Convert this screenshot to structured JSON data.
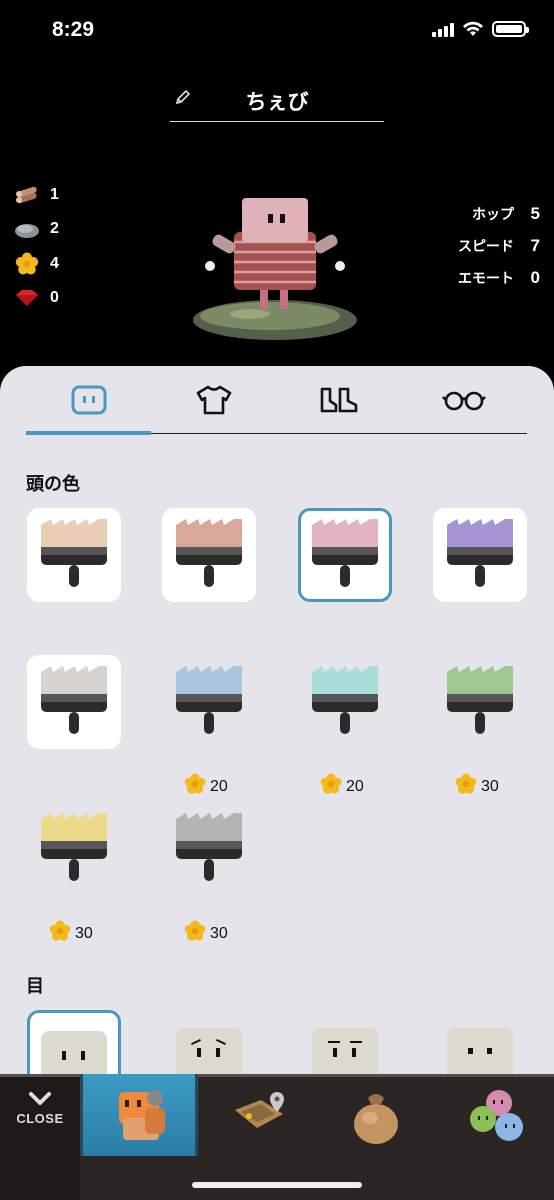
{
  "status_bar": {
    "time": "8:29"
  },
  "header": {
    "character_name": "ちぇび",
    "edit_icon": "pencil-icon"
  },
  "resources": [
    {
      "icon": "wood-logs-icon",
      "value": "1"
    },
    {
      "icon": "stone-icon",
      "value": "2"
    },
    {
      "icon": "flower-icon",
      "value": "4"
    },
    {
      "icon": "ruby-gem-icon",
      "value": "0"
    }
  ],
  "stats": [
    {
      "label": "ホップ",
      "value": "5"
    },
    {
      "label": "スピード",
      "value": "7"
    },
    {
      "label": "エモート",
      "value": "0"
    }
  ],
  "tabs": [
    {
      "icon": "face-icon",
      "active": true
    },
    {
      "icon": "shirt-icon",
      "active": false
    },
    {
      "icon": "boots-icon",
      "active": false
    },
    {
      "icon": "glasses-icon",
      "active": false
    }
  ],
  "head_color_section": {
    "title": "頭の色",
    "colors": [
      {
        "color": "#e9cdb4",
        "price": "",
        "owned": true,
        "selected": false
      },
      {
        "color": "#d8a899",
        "price": "",
        "owned": true,
        "selected": false
      },
      {
        "color": "#e2b3c0",
        "price": "",
        "owned": true,
        "selected": true
      },
      {
        "color": "#a794d3",
        "price": "",
        "owned": true,
        "selected": false
      },
      {
        "color": "#d6d4ce",
        "price": "",
        "owned": true,
        "selected": false
      },
      {
        "color": "#a9c6dd",
        "price": "20",
        "owned": false,
        "selected": false
      },
      {
        "color": "#a9dddb",
        "price": "20",
        "owned": false,
        "selected": false
      },
      {
        "color": "#9dc990",
        "price": "30",
        "owned": false,
        "selected": false
      },
      {
        "color": "#ecd98a",
        "price": "30",
        "owned": false,
        "selected": false
      },
      {
        "color": "#b5b4b5",
        "price": "30",
        "owned": false,
        "selected": false
      }
    ]
  },
  "eye_section": {
    "title": "目"
  },
  "bottom_nav": {
    "close_label": "CLOSE",
    "items": [
      "character-icon",
      "map-icon",
      "sack-icon",
      "friends-icon"
    ]
  }
}
